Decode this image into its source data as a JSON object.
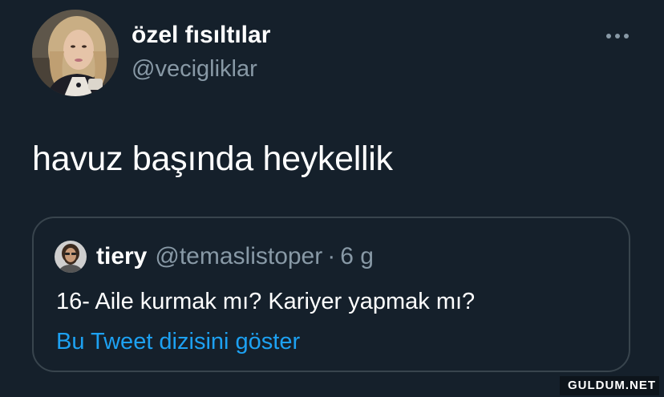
{
  "author": {
    "display_name": "özel fısıltılar",
    "handle": "@vecigliklar",
    "avatar": "profile-photo"
  },
  "menu": {
    "icon": "more-horizontal-icon"
  },
  "tweet": {
    "text": "havuz başında heykellik"
  },
  "quoted_tweet": {
    "name": "tiery",
    "handle": "@temaslistoper",
    "separator": "·",
    "time": "6 g",
    "avatar": "profile-photo",
    "text": "16- Aile kurmak mı? Kariyer yapmak mı?",
    "thread_link": "Bu Tweet dizisini göster"
  },
  "watermark": {
    "text": "GULDUM.NET"
  },
  "colors": {
    "background": "#15202b",
    "secondary_text": "#8899a6",
    "link": "#1da1f2",
    "border": "#38444d"
  }
}
